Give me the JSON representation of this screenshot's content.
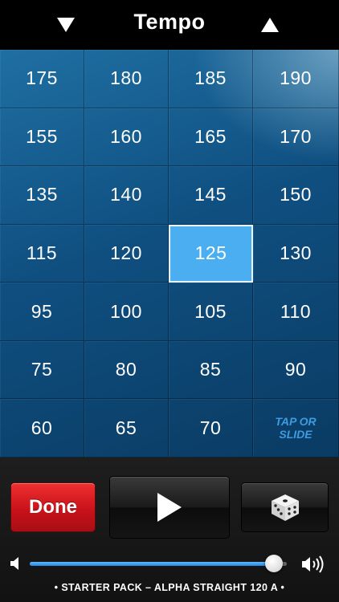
{
  "header": {
    "title": "Tempo",
    "decrease_icon": "triangle-down-icon",
    "increase_icon": "triangle-up-icon"
  },
  "grid": {
    "rows": [
      [
        "175",
        "180",
        "185",
        "190"
      ],
      [
        "155",
        "160",
        "165",
        "170"
      ],
      [
        "135",
        "140",
        "145",
        "150"
      ],
      [
        "115",
        "120",
        "125",
        "130"
      ],
      [
        "95",
        "100",
        "105",
        "110"
      ],
      [
        "75",
        "80",
        "85",
        "90"
      ],
      [
        "60",
        "65",
        "70",
        ""
      ]
    ],
    "selected": "125",
    "hint_line1": "TAP OR",
    "hint_line2": "SLIDE"
  },
  "controls": {
    "done_label": "Done",
    "play_icon": "play-icon",
    "dice_icon": "dice-icon",
    "volume": 0.95,
    "now_playing": "• STARTER PACK – ALPHA STRAIGHT 120 A •"
  },
  "colors": {
    "selected_cell": "#4aaef0",
    "done_button": "#d81c22",
    "hint_text": "#3d9be0",
    "slider_fill": "#3a98ee"
  }
}
